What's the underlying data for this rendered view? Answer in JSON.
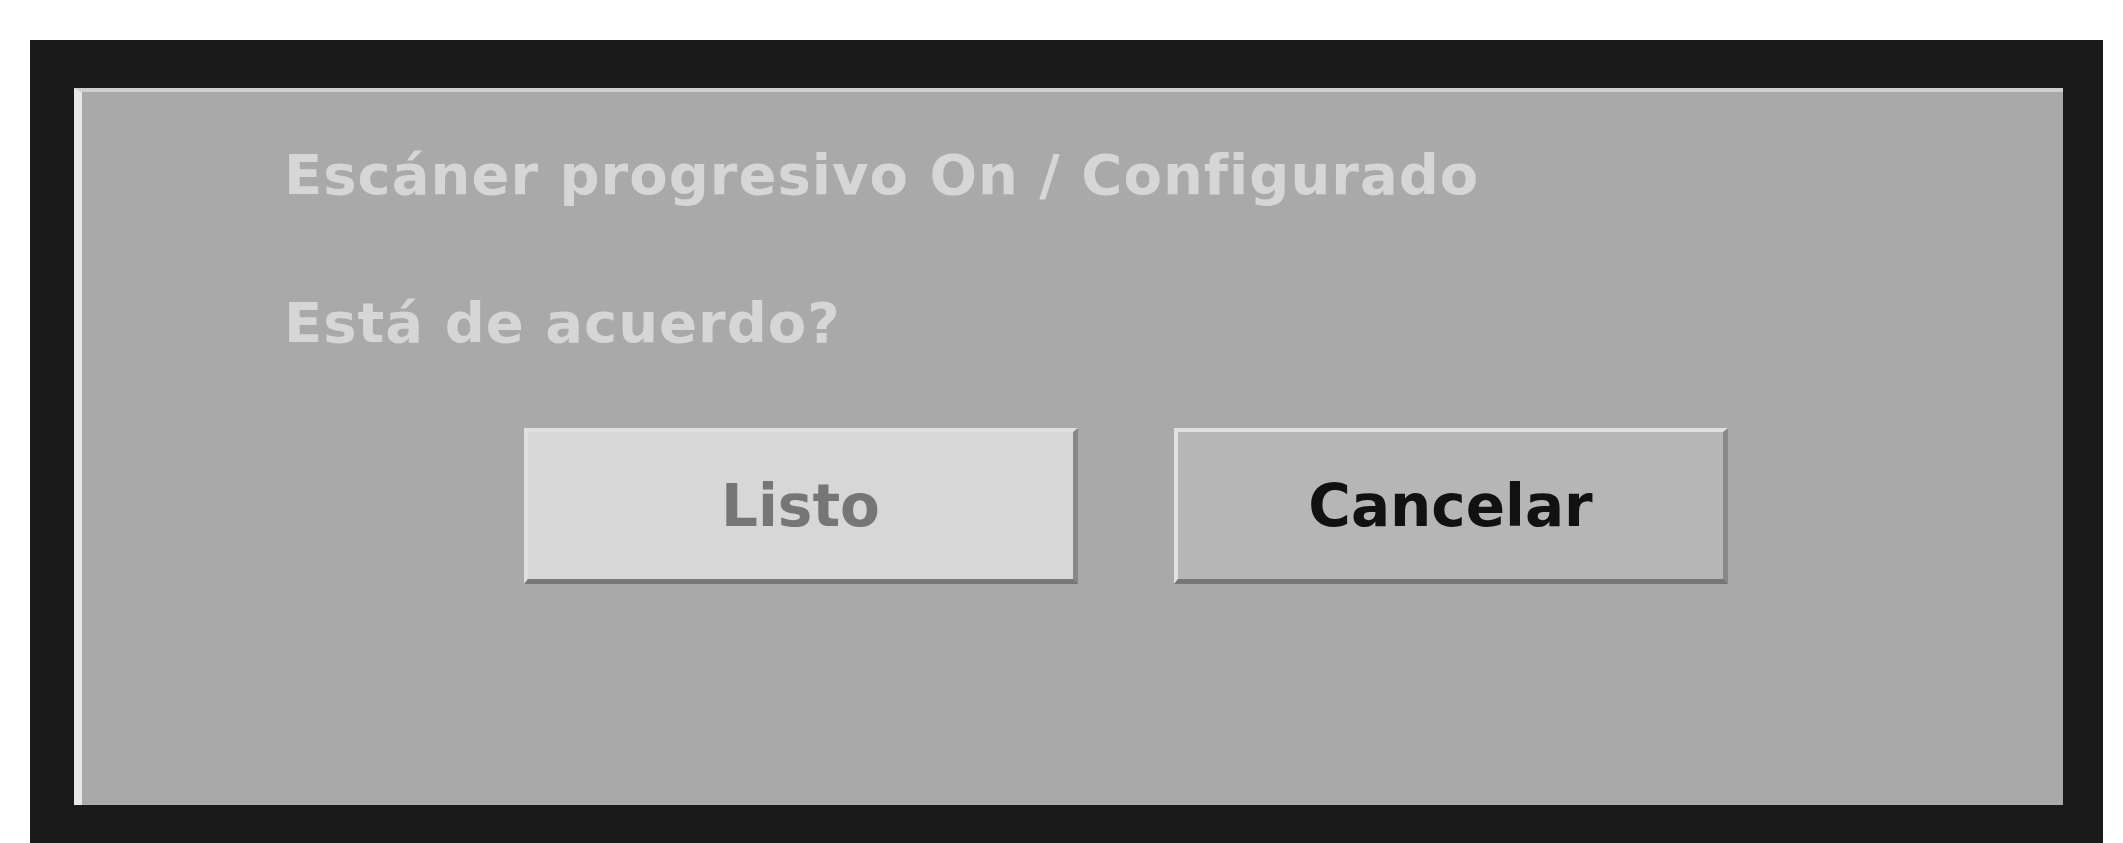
{
  "message": [
    "Escáner progresivo On / Configurado",
    "Está de acuerdo?"
  ],
  "buttons": [
    {
      "label": "Listo",
      "selected": true
    },
    {
      "label": "Cancelar",
      "selected": false
    }
  ]
}
